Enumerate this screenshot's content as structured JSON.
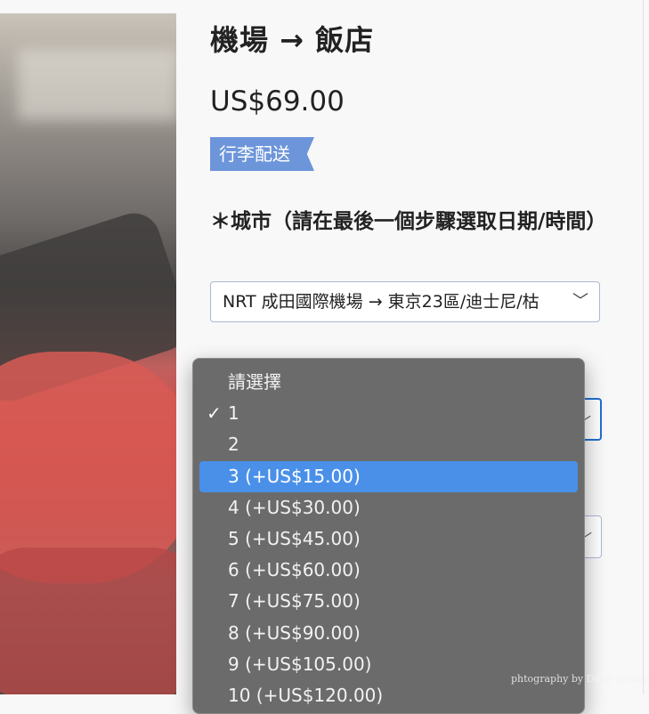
{
  "product": {
    "title": "機場 → 飯店",
    "price": "US$69.00",
    "tag": "行李配送"
  },
  "form": {
    "city_label": "＊城市（請在最後一個步驟選取日期/時間）",
    "city_value": "NRT 成田國際機場 → 東京23區/迪士尼/枯"
  },
  "dropdown": {
    "checked_index": 1,
    "highlighted_index": 3,
    "options": [
      "請選擇",
      "1",
      "2",
      "3 (+US$15.00)",
      "4 (+US$30.00)",
      "5 (+US$45.00)",
      "6 (+US$60.00)",
      "7 (+US$75.00)",
      "8 (+US$90.00)",
      "9 (+US$105.00)",
      "10 (+US$120.00)"
    ]
  },
  "watermark": "phtography by Daisy yohoho",
  "colors": {
    "accent": "#4a90e8",
    "tag": "#6d95da",
    "dropdown_bg": "#6b6b6b"
  },
  "icons": {
    "check": "check-icon",
    "chevron": "chevron-down-icon"
  }
}
